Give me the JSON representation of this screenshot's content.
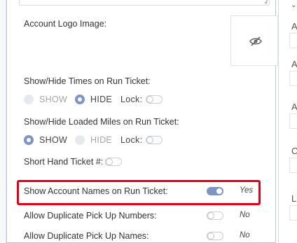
{
  "settings": {
    "account_logo_label": "Account Logo Image:",
    "show_hide_times_label": "Show/Hide Times on Run Ticket:",
    "show_hide_loaded_miles_label": "Show/Hide Loaded Miles on Run Ticket:",
    "show_option": "SHOW",
    "hide_option": "HIDE",
    "lock_label": "Lock:",
    "short_hand_label": "Short Hand Ticket #:",
    "show_account_names_label": "Show Account Names on Run Ticket:",
    "show_account_names_value": "Yes",
    "allow_dup_pickup_numbers_label": "Allow Duplicate Pick Up Numbers:",
    "allow_dup_pickup_numbers_value": "No",
    "allow_dup_pickup_names_label": "Allow Duplicate Pick Up Names:",
    "allow_dup_pickup_names_value": "No"
  },
  "state": {
    "times_selected": "HIDE",
    "times_lock": false,
    "loaded_miles_selected": "SHOW",
    "loaded_miles_lock": false,
    "short_hand": false,
    "show_account_names": true,
    "allow_dup_pickup_numbers": false,
    "allow_dup_pickup_names": false
  },
  "right_column": {
    "letters": [
      "A",
      "A",
      "A",
      "C",
      "L"
    ],
    "chevron": "chevron-down-icon"
  },
  "icons": {
    "logo_placeholder": "eye-slash-icon",
    "resize": "resize-grip-icon"
  },
  "colors": {
    "accent": "#7e95c4",
    "highlight": "#e0001a"
  }
}
